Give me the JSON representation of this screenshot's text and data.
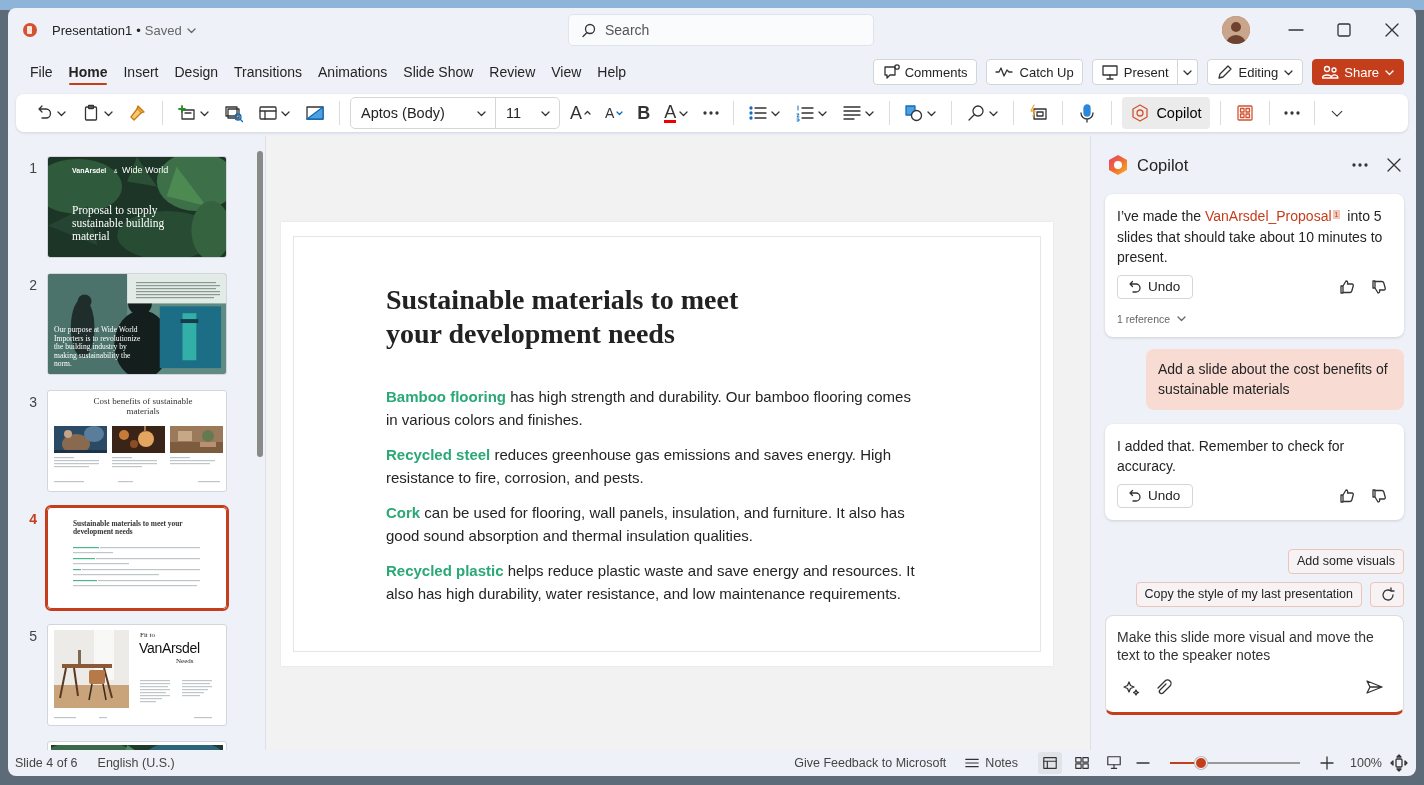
{
  "title_bar": {
    "file_name": "Presentation1",
    "separator": "•",
    "status": "Saved",
    "search": {
      "placeholder": "Search"
    }
  },
  "menu_tabs": [
    {
      "label": "File",
      "selected": false
    },
    {
      "label": "Home",
      "selected": true
    },
    {
      "label": "Insert",
      "selected": false
    },
    {
      "label": "Design",
      "selected": false
    },
    {
      "label": "Transitions",
      "selected": false
    },
    {
      "label": "Animations",
      "selected": false
    },
    {
      "label": "Slide Show",
      "selected": false
    },
    {
      "label": "Review",
      "selected": false
    },
    {
      "label": "View",
      "selected": false
    },
    {
      "label": "Help",
      "selected": false
    }
  ],
  "actions": [
    {
      "kind": "comments",
      "label": "Comments"
    },
    {
      "kind": "catch-up",
      "label": "Catch Up"
    },
    {
      "kind": "present",
      "label": "Present"
    },
    {
      "kind": "editing",
      "label": "Editing"
    },
    {
      "kind": "share",
      "label": "Share"
    }
  ],
  "ribbon": {
    "font": "Aptos (Body)",
    "font_size": "11",
    "grow_font": "A",
    "shrink_font": "A",
    "bold": "B",
    "font_color": "A",
    "copilot": {
      "label": "Copilot",
      "selected": true
    }
  },
  "slides": [
    {
      "number": "1",
      "kind": "cover",
      "selected": false,
      "logo_left": "VanArsdel",
      "logo_amp": "&",
      "logo_right": "Wide World",
      "title": "Proposal to supply sustainable building material"
    },
    {
      "number": "2",
      "kind": "quote",
      "selected": false,
      "quote": "Our purpose at Wide World Importers is to revolutionize the building industry by making sustainability the norm."
    },
    {
      "number": "3",
      "kind": "gallery",
      "selected": false,
      "title": "Cost benefits of sustainable materials"
    },
    {
      "number": "4",
      "kind": "text",
      "selected": true,
      "title": "Sustainable materials to meet your development needs"
    },
    {
      "number": "5",
      "kind": "feature",
      "selected": false,
      "kicker": "Fit to",
      "title": "VanArsdel",
      "subtitle": "Needs"
    },
    {
      "kind": "cut",
      "selected": false
    }
  ],
  "slide": {
    "title": "Sustainable materials to meet your development needs",
    "paragraphs": [
      "**Bamboo flooring** has high strength and durability. Our bamboo flooring comes in various colors and finishes.",
      "**Recycled steel** reduces greenhouse gas emissions and saves energy. High resistance to fire, corrosion, and pests.",
      "**Cork** can be used for flooring, wall panels, insulation, and furniture. It also has good sound absorption and thermal insulation qualities.",
      "**Recycled plastic** helps reduce plastic waste and save energy and resources. It also has high durability, water resistance, and low maintenance requirements."
    ]
  },
  "copilot": {
    "title": "Copilot",
    "messages": [
      {
        "kind": "assistant",
        "before": "I’ve made the ",
        "link": "VanArsdel_Proposal",
        "citation": "1",
        "after": " into 5 slides that should take about 10 minutes to present.",
        "undo": "Undo",
        "references": "1 reference"
      },
      {
        "kind": "user",
        "text": "Add a slide about the cost benefits of sustainable materials"
      },
      {
        "kind": "assistant",
        "text": "I added that. Remember to check for accuracy.",
        "undo": "Undo"
      }
    ],
    "suggestions": [
      "Add some visuals",
      "Copy the style of my last presentation"
    ],
    "prompt": {
      "value": "Make this slide more visual and move the text to the speaker notes"
    }
  },
  "status_bar": {
    "slide_info": "Slide 4 of 6",
    "language": "English (U.S.)",
    "feedback": "Give Feedback to Microsoft",
    "notes": "Notes",
    "views": [
      {
        "kind": "normal",
        "selected": true
      },
      {
        "kind": "sorter",
        "selected": false
      },
      {
        "kind": "reading",
        "selected": false
      }
    ],
    "zoom": {
      "level": 0.24,
      "reading": "100%"
    }
  }
}
